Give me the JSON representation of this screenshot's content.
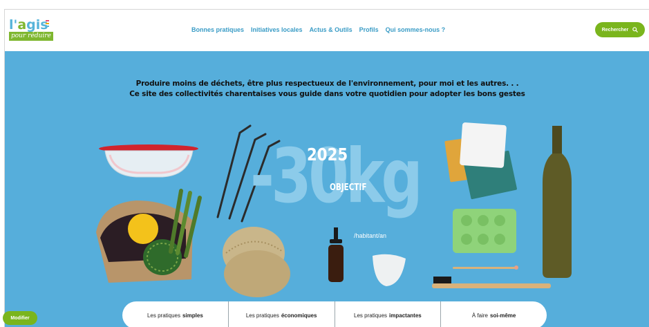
{
  "logo": {
    "top_text_1": "l'",
    "top_text_2": "a",
    "top_text_3": "gis",
    "bottom_text": "pour réduire"
  },
  "nav": {
    "items": [
      {
        "label": "Bonnes pratiques"
      },
      {
        "label": "Initiatives locales"
      },
      {
        "label": "Actus & Outils"
      },
      {
        "label": "Profils"
      },
      {
        "label": "Qui sommes-nous ?"
      }
    ]
  },
  "search": {
    "label": "Rechercher",
    "icon": "search-icon"
  },
  "hero": {
    "tagline_line1": "Produire moins de déchets, être plus respectueux de l'environnement, pour moi et les autres. . .",
    "tagline_line2": "Ce site des collectivités charentaises vous guide dans votre quotidien pour adopter les bons gestes",
    "year": "2025",
    "big_value": "-30kg",
    "objective_label": "OBJECTIF",
    "unit": "/habitant/an"
  },
  "tabs": [
    {
      "prefix": "Les pratiques",
      "bold": "simples"
    },
    {
      "prefix": "Les pratiques",
      "bold": "économiques"
    },
    {
      "prefix": "Les pratiques",
      "bold": "impactantes"
    },
    {
      "prefix": "À faire",
      "bold": "soi-même"
    }
  ],
  "modify": {
    "label": "Modifier"
  },
  "colors": {
    "brand_green": "#7ab51d",
    "brand_blue": "#56aedb",
    "nav_blue": "#3a9cc6"
  }
}
